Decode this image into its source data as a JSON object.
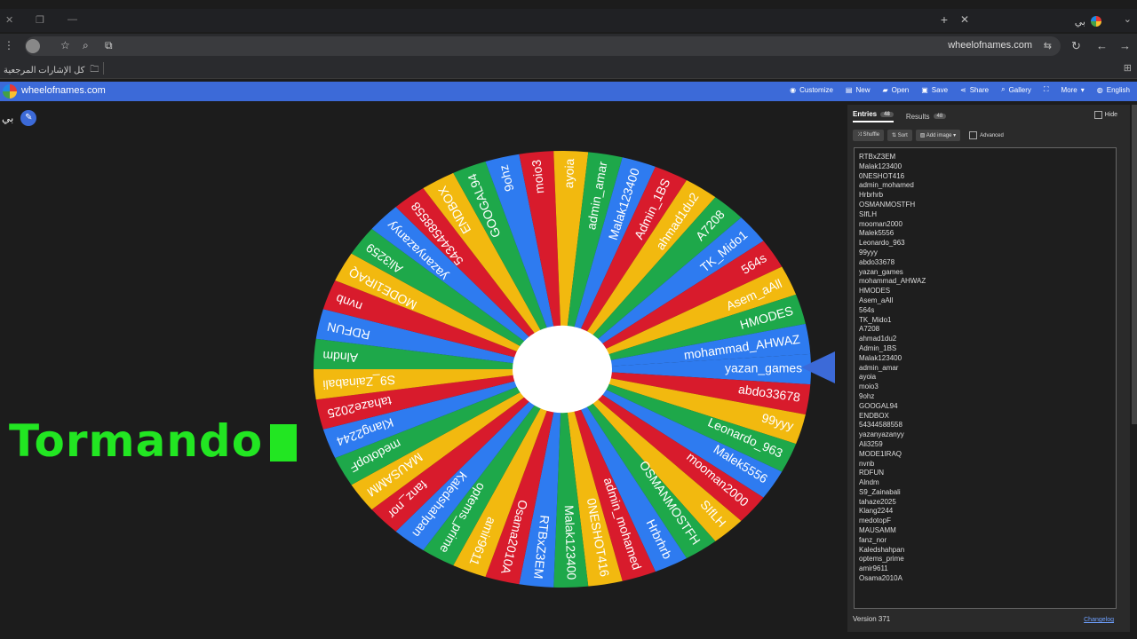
{
  "browser": {
    "url": "wheelofnames.com",
    "tab_title": "بي",
    "bookmarks_label": "كل الإشارات المرجعية"
  },
  "app": {
    "brand": "wheelofnames.com",
    "menu": [
      {
        "label": "Customize",
        "icon": "palette-icon"
      },
      {
        "label": "New",
        "icon": "new-file-icon"
      },
      {
        "label": "Open",
        "icon": "folder-icon"
      },
      {
        "label": "Save",
        "icon": "save-icon"
      },
      {
        "label": "Share",
        "icon": "share-icon"
      },
      {
        "label": "Gallery",
        "icon": "search-icon"
      },
      {
        "label": "",
        "icon": "fullscreen-icon"
      },
      {
        "label": "More",
        "icon": "chevron-down-icon"
      },
      {
        "label": "English",
        "icon": "globe-icon"
      }
    ],
    "wheel_title": "بي"
  },
  "overlay_text": "Tormando",
  "wheel": {
    "colors": [
      "#2e7bf0",
      "#d81b2c",
      "#f2b90f",
      "#1ea84a"
    ],
    "pointer_color": "#3c6ad8"
  },
  "panel": {
    "tab_entries": "Entries",
    "tab_entries_count": "48",
    "tab_results": "Results",
    "tab_results_count": "48",
    "hide_label": "Hide",
    "tools": {
      "shuffle": "Shuffle",
      "sort": "Sort",
      "add_image": "Add image",
      "advanced": "Advanced"
    },
    "entries": [
      "RTBxZ3EM",
      "Malak123400",
      "0NESHOT416",
      "admin_mohamed",
      "Hrbrhrb",
      "OSMANMOSTFH",
      "SIfLH",
      "mooman2000",
      "Malek5556",
      "Leonardo_963",
      "99yyy",
      "abdo33678",
      "yazan_games",
      "mohammad_AHWAZ",
      "HMODES",
      "Asem_aAll",
      "564s",
      "TK_Mido1",
      "A7208",
      "ahmad1du2",
      "Admin_1BS",
      "Malak123400",
      "admin_amar",
      "ayoia",
      "moio3",
      "9ohz",
      "GOOGAL94",
      "ENDBOX",
      "54344588558",
      "yazanyazanyy",
      "Ali3259",
      "MODE1IRAQ",
      "nvnb",
      "RDFUN",
      "Alndm",
      "S9_Zainabali",
      "tahaze2025",
      "Klang2244",
      "medotopF",
      "MAUSAMM",
      "fanz_nor",
      "Kaledshahpan",
      "optems_prime",
      "amir9611",
      "Osama2010A"
    ],
    "version": "Version 371",
    "changelog": "Changelog"
  },
  "wheel_labels": [
    "yazan_games",
    "abdo33678",
    "99yyy",
    "Leonardo_963",
    "Malek5556",
    "mooman2000",
    "SIfLH",
    "OSMANMOSTFH",
    "Hrbrhrb",
    "admin_mohamed",
    "0NESHOT416",
    "Malak123400",
    "RTBxZ3EM",
    "Osama2010A",
    "amir9611",
    "optems_prime",
    "Kaledshahpan",
    "fanz_nor",
    "MAUSAMM",
    "medotopF",
    "Klang2244",
    "tahaze2025",
    "S9_Zainabali",
    "Alndm",
    "RDFUN",
    "nvnb",
    "MODE1IRAQ",
    "Ali3259",
    "yazanyazanyy",
    "54344588558",
    "ENDBOX",
    "GOOGAL94",
    "9ohz",
    "moio3",
    "ayoia",
    "admin_amar",
    "Malak123400",
    "Admin_1BS",
    "ahmad1du2",
    "A7208",
    "TK_Mido1",
    "564s",
    "Asem_aAll",
    "HMODES",
    "mohammad_AHWAZ"
  ]
}
